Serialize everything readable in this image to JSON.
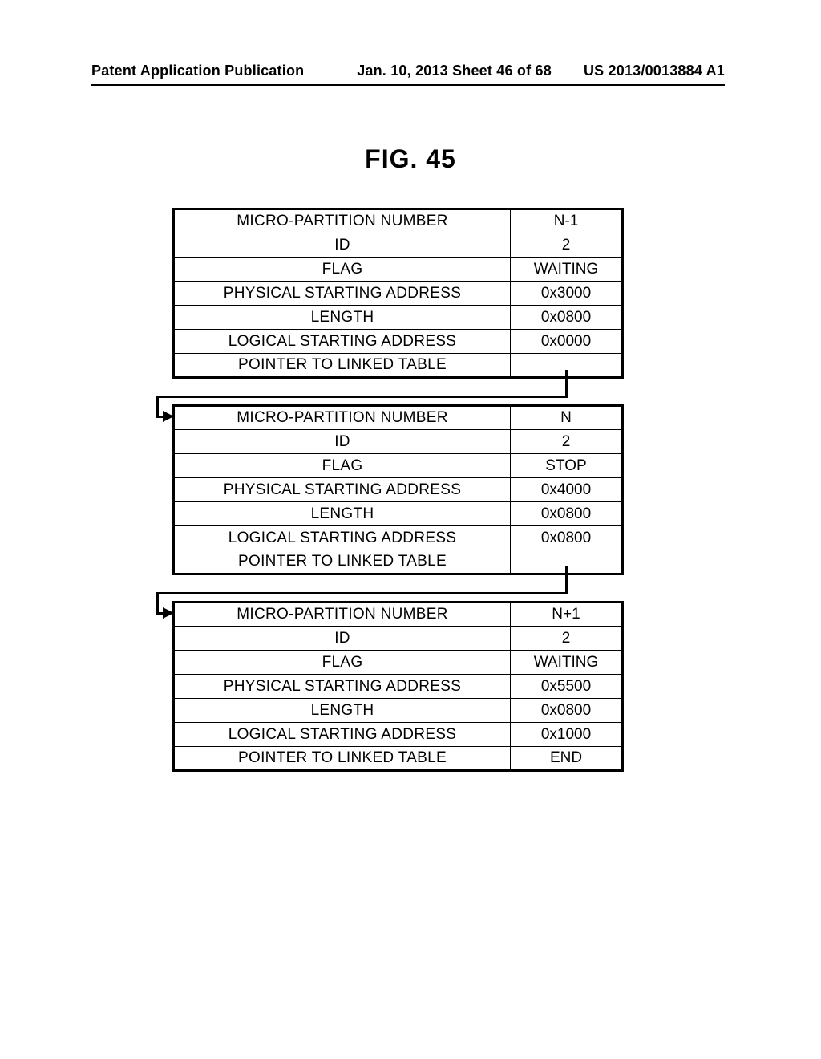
{
  "header": {
    "left": "Patent Application Publication",
    "center": "Jan. 10, 2013  Sheet 46 of 68",
    "right": "US 2013/0013884 A1"
  },
  "figure_title": "FIG. 45",
  "row_labels": {
    "micro_partition_number": "MICRO-PARTITION NUMBER",
    "id": "ID",
    "flag": "FLAG",
    "physical_starting_address": "PHYSICAL STARTING ADDRESS",
    "length": "LENGTH",
    "logical_starting_address": "LOGICAL STARTING ADDRESS",
    "pointer_to_linked_table": "POINTER TO LINKED TABLE"
  },
  "tables": [
    {
      "micro_partition_number": "N-1",
      "id": "2",
      "flag": "WAITING",
      "physical_starting_address": "0x3000",
      "length": "0x0800",
      "logical_starting_address": "0x0000",
      "pointer_to_linked_table": ""
    },
    {
      "micro_partition_number": "N",
      "id": "2",
      "flag": "STOP",
      "physical_starting_address": "0x4000",
      "length": "0x0800",
      "logical_starting_address": "0x0800",
      "pointer_to_linked_table": ""
    },
    {
      "micro_partition_number": "N+1",
      "id": "2",
      "flag": "WAITING",
      "physical_starting_address": "0x5500",
      "length": "0x0800",
      "logical_starting_address": "0x1000",
      "pointer_to_linked_table": "END"
    }
  ]
}
